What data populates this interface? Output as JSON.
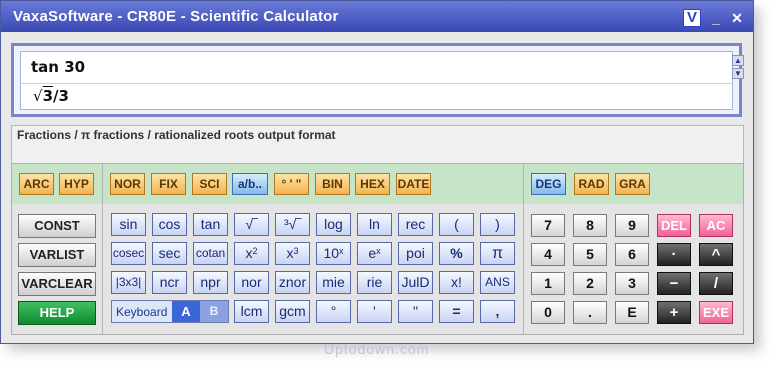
{
  "window": {
    "title": "VaxaSoftware - CR80E - Scientific Calculator",
    "btn_v": "V",
    "btn_min": "_",
    "btn_close": "✕"
  },
  "display": {
    "expression": "tan 30",
    "result_num": "3",
    "result_den": "/3",
    "result_radical": "√"
  },
  "format_text": "Fractions / π fractions / rationalized roots output format",
  "watermark": "Uptodown.com",
  "mode_keys": {
    "left": [
      "ARC",
      "HYP"
    ],
    "middle": [
      "NOR",
      "FIX",
      "SCI",
      "a/b..",
      "° ' \"",
      "BIN",
      "HEX",
      "DATE"
    ],
    "right": [
      "DEG",
      "RAD",
      "GRA"
    ]
  },
  "side_keys": [
    "CONST",
    "VARLIST",
    "VARCLEAR",
    "HELP"
  ],
  "fn_rows": [
    [
      "sin",
      "cos",
      "tan",
      "√‾",
      "³√‾",
      "log",
      "ln",
      "rec",
      "(",
      ")"
    ],
    [
      "cosec",
      "sec",
      "cotan",
      "x2",
      "x3",
      "10x",
      "ex",
      "poi",
      "%",
      "π"
    ],
    [
      "|3x3|",
      "ncr",
      "npr",
      "nor",
      "znor",
      "mie",
      "rie",
      "JulD",
      "x!",
      "ANS"
    ],
    [
      "lcm",
      "gcm",
      "°",
      "'",
      "\"",
      "=",
      ","
    ]
  ],
  "keyboard": {
    "label": "Keyboard",
    "a": "A",
    "b": "B"
  },
  "num_rows": [
    [
      "7",
      "8",
      "9",
      "DEL",
      "AC"
    ],
    [
      "4",
      "5",
      "6",
      "·",
      "^"
    ],
    [
      "1",
      "2",
      "3",
      "−",
      "/"
    ],
    [
      "0",
      ".",
      "E",
      "+",
      "EXE"
    ]
  ],
  "colors": {
    "title_bar": "#3a48b4",
    "mode_strip": "#c8e4c8",
    "help": "#108a30",
    "delete": "#f06298"
  }
}
